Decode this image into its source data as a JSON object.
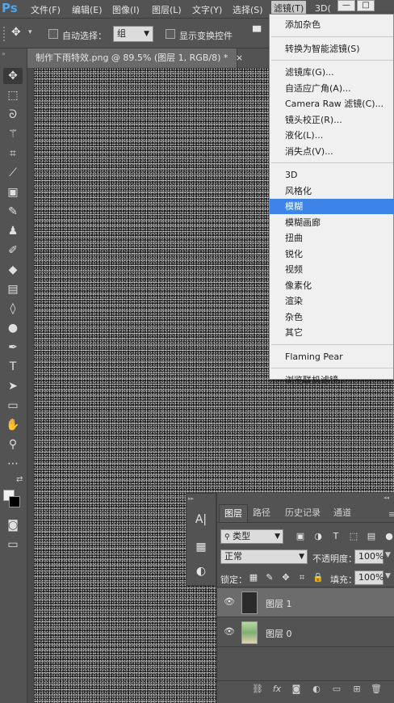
{
  "menubar": {
    "logo": "Ps",
    "items": [
      "文件(F)",
      "编辑(E)",
      "图像(I)",
      "图层(L)",
      "文字(Y)",
      "选择(S)",
      "滤镜(T)",
      "3D(D)"
    ],
    "active_index": 6,
    "window_buttons": [
      "—",
      "□"
    ]
  },
  "options": {
    "auto_select_label": "自动选择：",
    "auto_select_value": "组",
    "show_transform_label": "显示变换控件"
  },
  "document": {
    "tab_title": "制作下雨特效.png @ 89.5% (图层 1, RGB/8) *",
    "close_glyph": "×"
  },
  "filter_menu": {
    "items": [
      {
        "label": "添加杂色",
        "group": 0
      },
      {
        "label": "转换为智能滤镜(S)",
        "group": 1
      },
      {
        "label": "滤镜库(G)...",
        "group": 2
      },
      {
        "label": "自适应广角(A)...",
        "group": 2
      },
      {
        "label": "Camera Raw 滤镜(C)...",
        "group": 2
      },
      {
        "label": "镜头校正(R)...",
        "group": 2
      },
      {
        "label": "液化(L)...",
        "group": 2
      },
      {
        "label": "消失点(V)...",
        "group": 2
      },
      {
        "label": "3D",
        "group": 3
      },
      {
        "label": "风格化",
        "group": 3
      },
      {
        "label": "模糊",
        "group": 3,
        "highlighted": true
      },
      {
        "label": "模糊画廊",
        "group": 3
      },
      {
        "label": "扭曲",
        "group": 3
      },
      {
        "label": "锐化",
        "group": 3
      },
      {
        "label": "视频",
        "group": 3
      },
      {
        "label": "像素化",
        "group": 3
      },
      {
        "label": "渲染",
        "group": 3
      },
      {
        "label": "杂色",
        "group": 3
      },
      {
        "label": "其它",
        "group": 3
      },
      {
        "label": "Flaming Pear",
        "group": 4
      },
      {
        "label": "浏览联机滤镜...",
        "group": 5
      }
    ]
  },
  "layers_panel": {
    "tabs": [
      "图层",
      "路径",
      "历史记录",
      "通道"
    ],
    "active_tab": 0,
    "filter_type": "类型",
    "blend_mode": "正常",
    "opacity_label": "不透明度：",
    "opacity_value": "100%",
    "lock_label": "锁定：",
    "fill_label": "填充：",
    "fill_value": "100%",
    "layers": [
      {
        "name": "图层 1",
        "selected": true
      },
      {
        "name": "图层 0",
        "selected": false
      }
    ]
  },
  "colors": {
    "highlight": "#3d84e8",
    "ui_bg": "#535353"
  }
}
